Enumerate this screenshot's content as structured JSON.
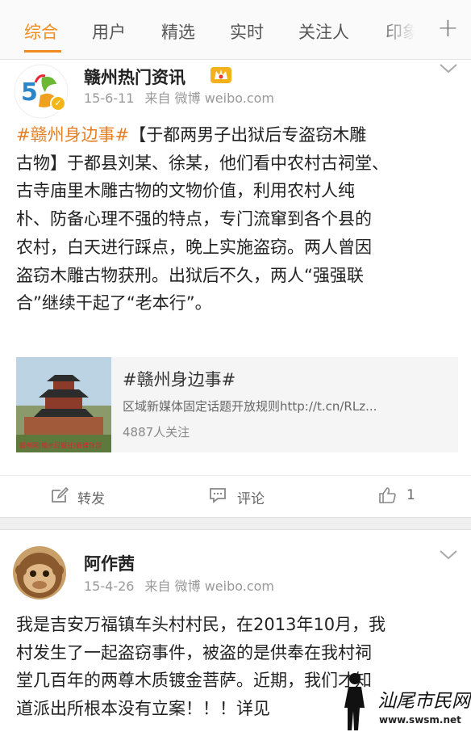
{
  "tabs": [
    {
      "label": "综合",
      "active": true
    },
    {
      "label": "用户",
      "active": false
    },
    {
      "label": "精选",
      "active": false
    },
    {
      "label": "实时",
      "active": false
    },
    {
      "label": "关注人",
      "active": false
    },
    {
      "label": "印象",
      "active": false
    }
  ],
  "tab_plus": "+",
  "accent_color": "#f08c1e",
  "post1": {
    "user": "赣州热门资讯",
    "date": "15-6-11",
    "source": "来自 微博 weibo.com",
    "hashtag": "#赣州身边事#",
    "lines": [
      "【于都两男子出狱后专盗窃木雕",
      "古物】于都县刘某、徐某，他们看中农村古祠堂、",
      "古寺庙里木雕古物的文物价值，利用农村人纯",
      "朴、防备心理不强的特点，专门流窜到各个县的",
      "农村，白天进行踩点，晚上实施盗窃。两人曾因",
      "盗窃木雕古物获刑。出狱后不久，两人“强强联",
      "合”继续干起了“老本行”。"
    ],
    "share": {
      "title": "#赣州身边事#",
      "desc": "区域新媒体固定话题开放规则http://t.cn/RLz...",
      "followers": "4887人关注",
      "thumb_caption": "赣州网(赣州日报社)新媒体部"
    },
    "actions": {
      "repost": "转发",
      "comment": "评论",
      "like_count": "1"
    }
  },
  "post2": {
    "user": "阿作茜",
    "date": "15-4-26",
    "source": "来自 微博 weibo.com",
    "lines": [
      "我是吉安万福镇车头村村民，在2013年10月，我",
      "村发生了一起盗窃事件，被盗的是供奉在我村祠",
      "堂几百年的两尊木质镀金菩萨。近期，我们才知",
      "道派出所根本没有立案！！！详见"
    ]
  },
  "watermark": {
    "name": "汕尾市民网",
    "url": "www.swsm.net"
  },
  "icons": [
    "chevron-down-icon",
    "verified-badge-icon",
    "crown-badge-icon",
    "repost-icon",
    "comment-icon",
    "like-icon"
  ]
}
